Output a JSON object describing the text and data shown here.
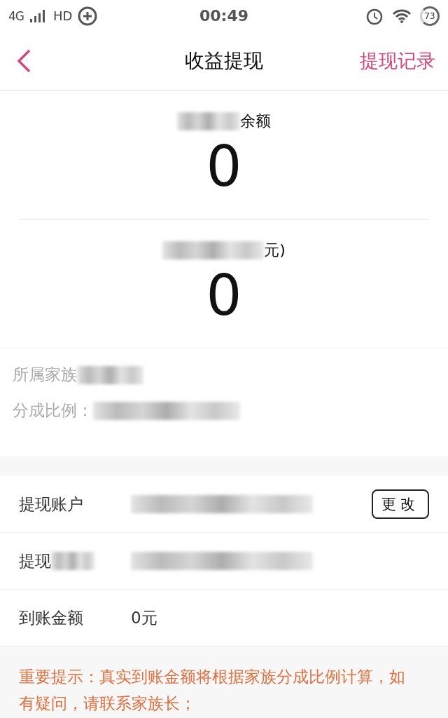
{
  "status_bar": {
    "network": "4G",
    "hd": "HD",
    "time": "00:49",
    "battery": "73"
  },
  "header": {
    "title": "收益提现",
    "action": "提现记录"
  },
  "balances": [
    {
      "label": "余额",
      "amount": "0",
      "redacted": true
    },
    {
      "label": "元)",
      "amount": "0",
      "redacted": true
    }
  ],
  "info": [
    {
      "label": "所属家族",
      "redacted": true
    },
    {
      "label": "分成比例：",
      "redacted": true
    }
  ],
  "rows": [
    {
      "label": "提现账户",
      "value_redacted": true,
      "button": "更改"
    },
    {
      "label": "提现",
      "label_redacted": true,
      "value_redacted": true
    },
    {
      "label": "到账金额",
      "value": "0元"
    }
  ],
  "notice": "重要提示：真实到账金额将根据家族分成比例计算，如有疑问，请联系家族长；"
}
